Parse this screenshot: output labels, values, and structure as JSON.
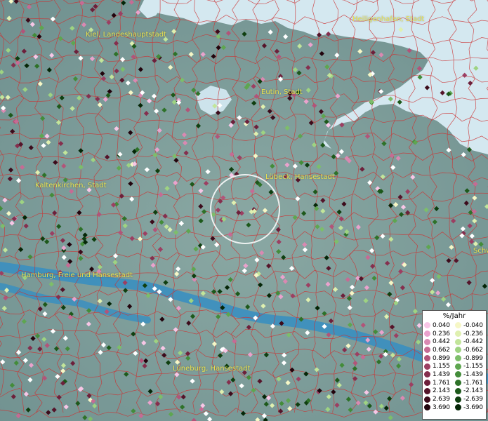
{
  "places": [
    {
      "name": "Kiel, Landeshauptstadt",
      "id": "kiel"
    },
    {
      "name": "Heiligenhafen, Stadt",
      "id": "heiligenhafen"
    },
    {
      "name": "Eutin, Stadt",
      "id": "eutin"
    },
    {
      "name": "Kaltenkirchen, Stadt",
      "id": "kaltenkirchen"
    },
    {
      "name": "Lübeck, Hansestadt",
      "id": "luebeck"
    },
    {
      "name": "Hamburg, Freie und Hansestadt",
      "id": "hamburg"
    },
    {
      "name": "Lüneburg, Hansestadt",
      "id": "lueneburg"
    },
    {
      "name": "Schw",
      "id": "schw"
    }
  ],
  "legend": {
    "unit": "%/Jahr",
    "positive": [
      {
        "label": "0.040",
        "color": "#f7c6e6"
      },
      {
        "label": "0.236",
        "color": "#eaa2cd"
      },
      {
        "label": "0.442",
        "color": "#d989b2"
      },
      {
        "label": "0.662",
        "color": "#c66b94"
      },
      {
        "label": "0.899",
        "color": "#b25479"
      },
      {
        "label": "1.155",
        "color": "#9c3f62"
      },
      {
        "label": "1.439",
        "color": "#852f4e"
      },
      {
        "label": "1.761",
        "color": "#6d203b"
      },
      {
        "label": "2.143",
        "color": "#55142a"
      },
      {
        "label": "2.639",
        "color": "#3c0b1b"
      },
      {
        "label": "3.690",
        "color": "#22040d"
      }
    ],
    "negative": [
      {
        "label": "-0.040",
        "color": "#f6f7c6"
      },
      {
        "label": "-0.236",
        "color": "#dff0b0"
      },
      {
        "label": "-0.442",
        "color": "#c2e59a"
      },
      {
        "label": "-0.662",
        "color": "#9ed382"
      },
      {
        "label": "-0.899",
        "color": "#7dbe6a"
      },
      {
        "label": "-1.155",
        "color": "#5ea650"
      },
      {
        "label": "-1.439",
        "color": "#438c3a"
      },
      {
        "label": "-1.761",
        "color": "#2e7229"
      },
      {
        "label": "-2.143",
        "color": "#1d591b"
      },
      {
        "label": "-2.639",
        "color": "#0f3f10"
      },
      {
        "label": "-3.690",
        "color": "#052607"
      }
    ]
  },
  "colors": {
    "land": "#7d9e9b",
    "sea": "#cfe6ef",
    "river": "#3a8fc0",
    "boundary": "#d23a3a",
    "label": "#e8e050",
    "circle": "#ffffff"
  }
}
